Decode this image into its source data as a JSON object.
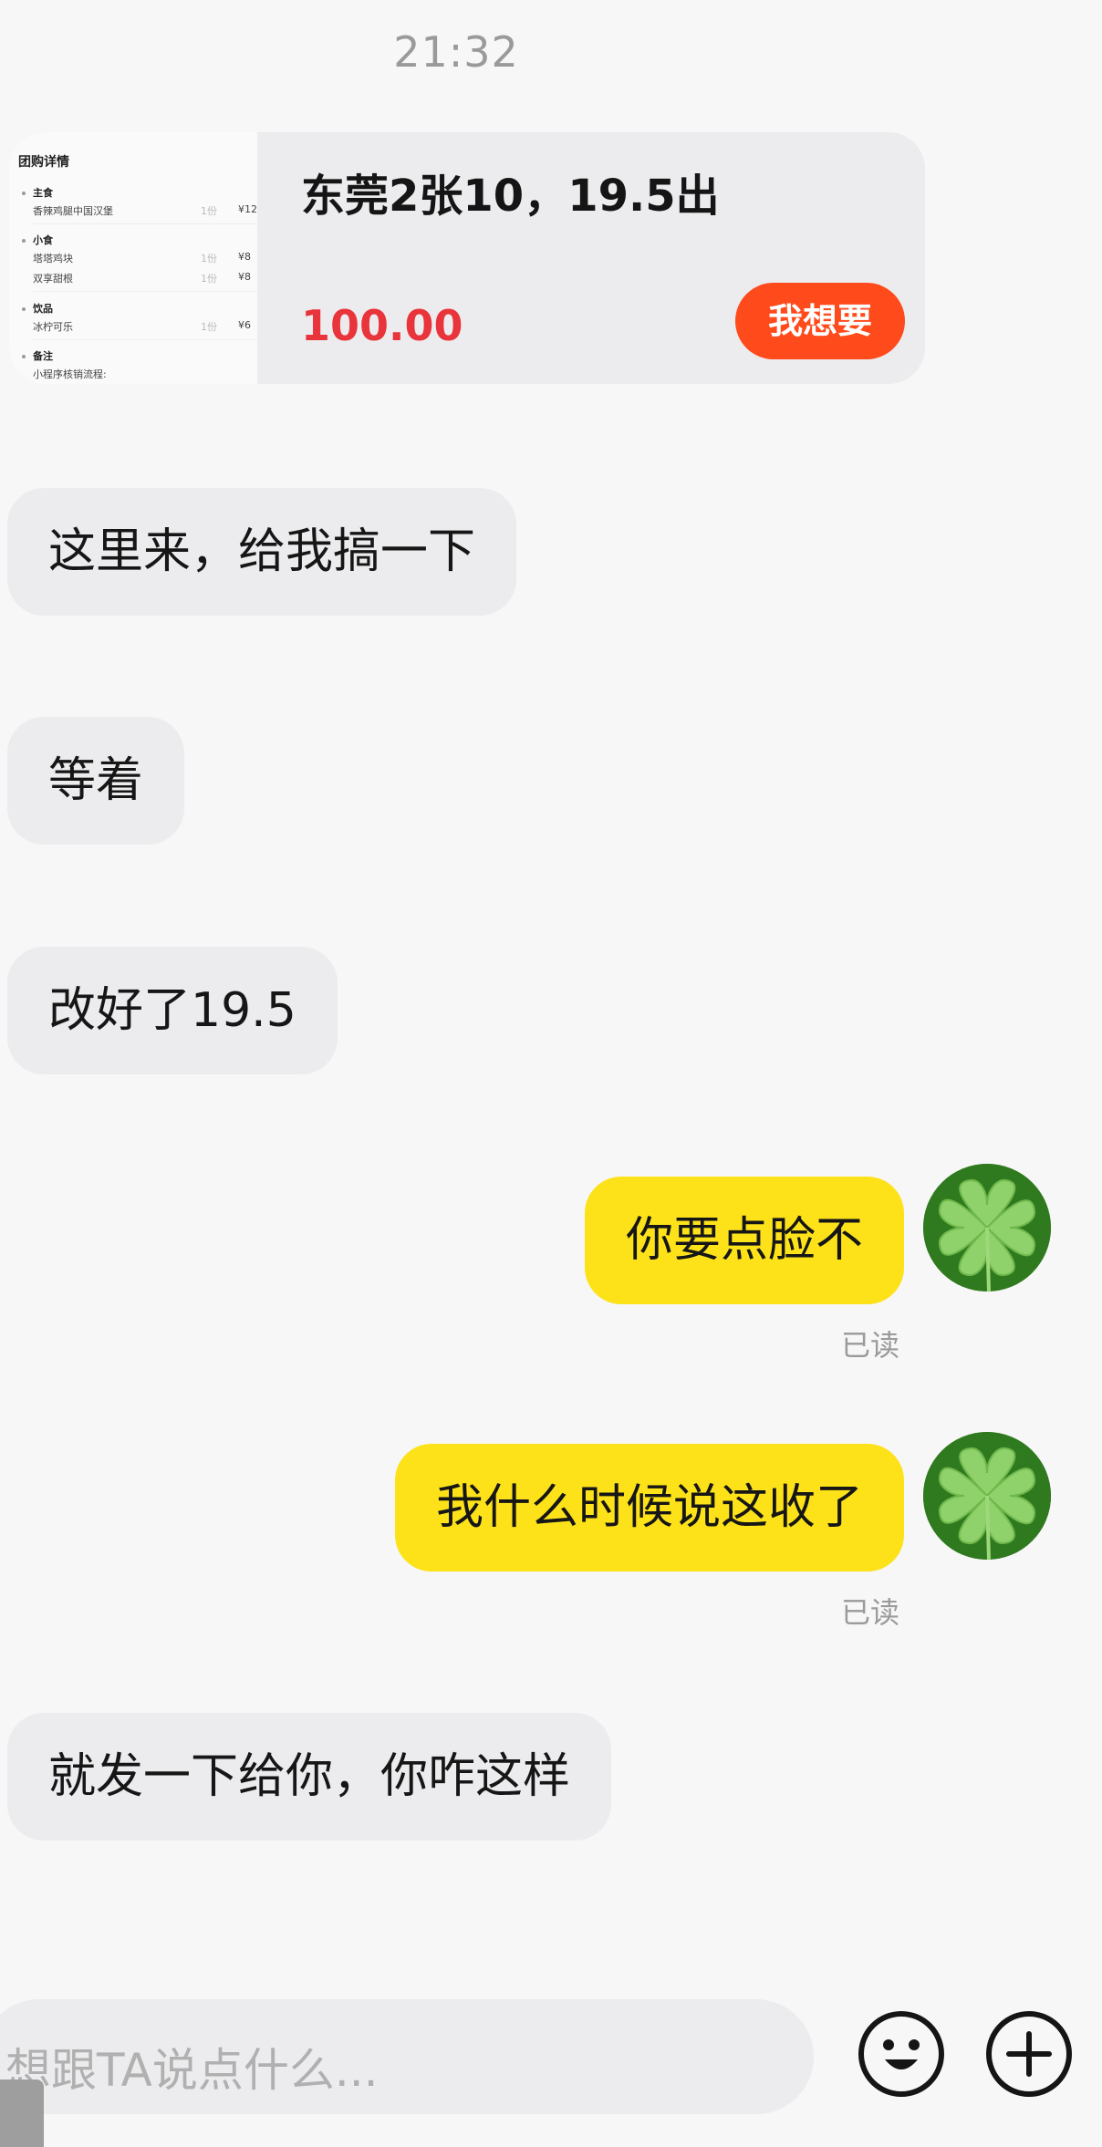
{
  "status": {
    "time": "21:32"
  },
  "product_card": {
    "title": "东莞2张10，19.5出",
    "price": "100.00",
    "button_label": "我想要",
    "thumbnail": {
      "heading": "团购详情",
      "sections": [
        {
          "name": "主食",
          "items": [
            {
              "name": "香辣鸡腿中国汉堡",
              "qty": "1份",
              "price": "¥12"
            }
          ]
        },
        {
          "name": "小食",
          "items": [
            {
              "name": "塔塔鸡块",
              "qty": "1份",
              "price": "¥8"
            },
            {
              "name": "双享甜根",
              "qty": "1份",
              "price": "¥8"
            }
          ]
        },
        {
          "name": "饮品",
          "items": [
            {
              "name": "冰柠可乐",
              "qty": "1份",
              "price": "¥6"
            }
          ]
        },
        {
          "name": "备注",
          "items": [
            {
              "name": "小程序核销流程:",
              "qty": "",
              "price": ""
            }
          ]
        }
      ]
    }
  },
  "messages": [
    {
      "from": "other",
      "text": "这里来，给我搞一下"
    },
    {
      "from": "other",
      "text": "等着"
    },
    {
      "from": "other",
      "text": "改好了19.5"
    },
    {
      "from": "me",
      "text": "你要点脸不",
      "status": "已读"
    },
    {
      "from": "me",
      "text": "我什么时候说这收了",
      "status": "已读"
    },
    {
      "from": "other",
      "text": "就发一下给你，你咋这样"
    }
  ],
  "input": {
    "placeholder": "想跟TA说点什么..."
  },
  "icons": {
    "emoji": "smiley-face-icon",
    "more": "plus-circle-icon",
    "avatar": "four-leaf-clover-avatar"
  },
  "colors": {
    "outgoing_bubble": "#fde21a",
    "incoming_bubble": "#ececee",
    "price_red": "#e8343a",
    "button_orange": "#ff4a1c"
  }
}
